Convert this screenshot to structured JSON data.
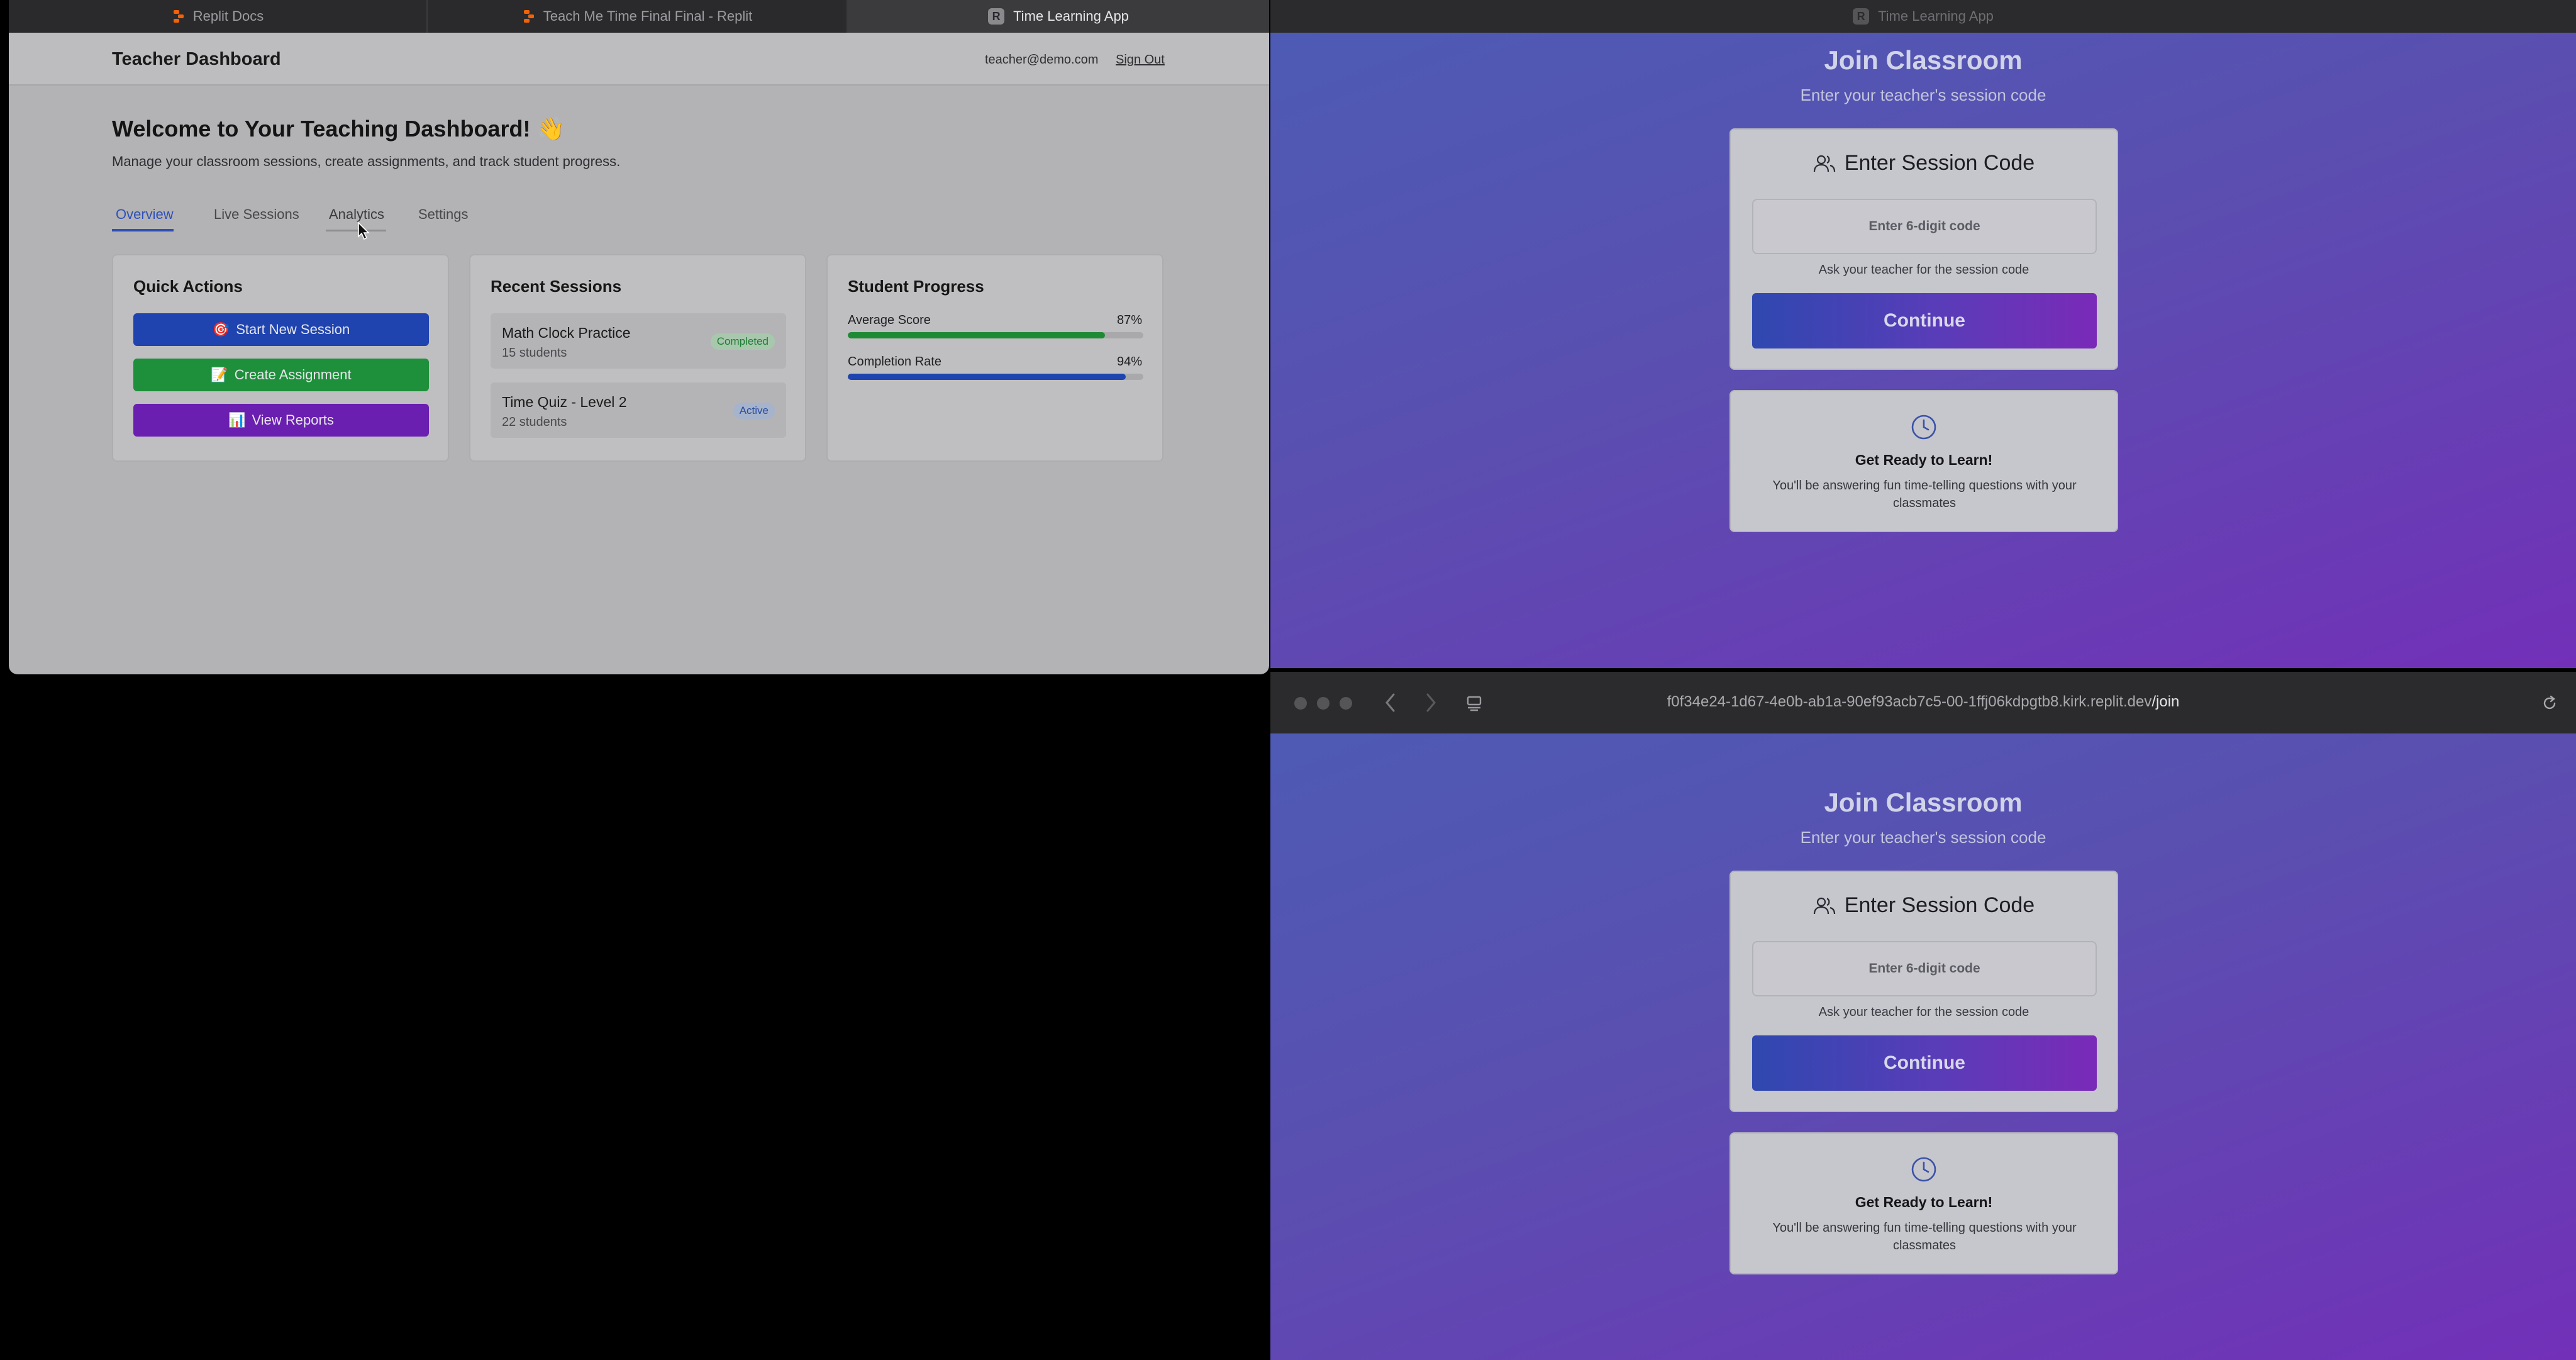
{
  "browser_tabs": [
    {
      "label": "Replit Docs",
      "icon": "replit-icon"
    },
    {
      "label": "Teach Me Time Final Final - Replit",
      "icon": "replit-icon"
    },
    {
      "label": "Time Learning App",
      "icon": "letter-r-icon",
      "icon_letter": "R",
      "active": true
    }
  ],
  "dashboard": {
    "title": "Teacher Dashboard",
    "email": "teacher@demo.com",
    "signout_label": "Sign Out",
    "welcome": "Welcome to Your Teaching Dashboard! 👋",
    "subtitle": "Manage your classroom sessions, create assignments, and track student progress.",
    "tabs": [
      {
        "label": "Overview",
        "active": true
      },
      {
        "label": "Live Sessions"
      },
      {
        "label": "Analytics",
        "hovered": true
      },
      {
        "label": "Settings"
      }
    ],
    "quick_actions": {
      "title": "Quick Actions",
      "buttons": [
        {
          "emoji": "🎯",
          "label": "Start New Session",
          "color": "#1f44b0"
        },
        {
          "emoji": "📝",
          "label": "Create Assignment",
          "color": "#1e8f3a"
        },
        {
          "emoji": "📊",
          "label": "View Reports",
          "color": "#6a1fb0"
        }
      ]
    },
    "recent_sessions": {
      "title": "Recent Sessions",
      "items": [
        {
          "name": "Math Clock Practice",
          "students": "15 students",
          "status": "Completed",
          "status_bg": "#a8c8ad",
          "status_color": "#1f7a35"
        },
        {
          "name": "Time Quiz - Level 2",
          "students": "22 students",
          "status": "Active",
          "status_bg": "#a6b3cc",
          "status_color": "#2a4f9c"
        }
      ]
    },
    "student_progress": {
      "title": "Student Progress",
      "metrics": [
        {
          "label": "Average Score",
          "value": "87%",
          "fraction": 0.87,
          "color": "#1f8a35"
        },
        {
          "label": "Completion Rate",
          "value": "94%",
          "fraction": 0.94,
          "color": "#1f44b0"
        }
      ]
    }
  },
  "join_window_top": {
    "tab_label": "Time Learning App",
    "tab_icon_letter": "R",
    "title": "Join Classroom",
    "subtitle": "Enter your teacher's session code",
    "card_title": "Enter Session Code",
    "input_placeholder": "Enter 6-digit code",
    "hint": "Ask your teacher for the session code",
    "continue_label": "Continue",
    "ready_title": "Get Ready to Learn!",
    "ready_text": "You'll be answering fun time-telling questions with your classmates"
  },
  "join_window_bottom": {
    "url_host": "f0f34e24-1d67-4e0b-ab1a-90ef93acb7c5-00-1ffj06kdpgtb8.kirk.replit.dev",
    "url_path": "/join",
    "title": "Join Classroom",
    "subtitle": "Enter your teacher's session code",
    "card_title": "Enter Session Code",
    "input_placeholder": "Enter 6-digit code",
    "hint": "Ask your teacher for the session code",
    "continue_label": "Continue",
    "ready_title": "Get Ready to Learn!",
    "ready_text": "You'll be answering fun time-telling questions with your classmates"
  }
}
